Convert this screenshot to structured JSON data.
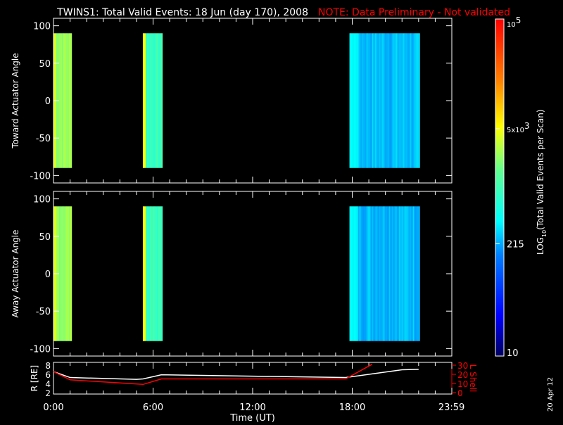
{
  "title": {
    "main": "TWINS1: Total Valid Events: 18 Jun (day 170), 2008",
    "note": "NOTE: Data Preliminary - Not validated",
    "note_color": "#ff0000"
  },
  "side_stamp": "20 Apr 12",
  "chart_data": [
    {
      "type": "heatmap",
      "panel": "top",
      "ylabel": "Toward Actuator Angle",
      "ylim": [
        -110,
        110
      ],
      "yticks": [
        100,
        50,
        0,
        -50,
        -100
      ],
      "xlim_hours": [
        0,
        24
      ],
      "blocks": [
        {
          "start": "0:00",
          "end": "1:03",
          "ymin": -90,
          "ymax": 90,
          "level": 2500,
          "edge_level": 4000
        },
        {
          "start": "5:23",
          "end": "6:32",
          "ymin": -90,
          "ymax": 90,
          "level": 900,
          "edge_level": 5000
        },
        {
          "start": "17:50",
          "end": "22:00",
          "ymin": -90,
          "ymax": 90,
          "level": 260,
          "edge_level": 400
        }
      ]
    },
    {
      "type": "heatmap",
      "panel": "middle",
      "ylabel": "Away Actuator Angle",
      "ylim": [
        -110,
        110
      ],
      "yticks": [
        100,
        50,
        0,
        -50,
        -100
      ],
      "xlim_hours": [
        0,
        24
      ],
      "blocks": [
        {
          "start": "0:00",
          "end": "1:03",
          "ymin": -90,
          "ymax": 90,
          "level": 2500,
          "edge_level": 4000
        },
        {
          "start": "5:23",
          "end": "6:32",
          "ymin": -90,
          "ymax": 90,
          "level": 900,
          "edge_level": 5000
        },
        {
          "start": "17:50",
          "end": "22:00",
          "ymin": -90,
          "ymax": 90,
          "level": 260,
          "edge_level": 400
        }
      ]
    },
    {
      "type": "line",
      "panel": "ephemeris",
      "xlabel": "Time (UT)",
      "xticks": [
        "0:00",
        "6:00",
        "12:00",
        "18:00",
        "23:59"
      ],
      "left_axis": {
        "label": "R [RE]",
        "ylim": [
          2,
          8
        ],
        "ticks": [
          "8",
          "6",
          "4",
          "2"
        ],
        "color": "#ffffff"
      },
      "right_axis": {
        "label": "L Shell",
        "ylim": [
          0,
          30
        ],
        "ticks": [
          "30",
          "20",
          "10",
          "0"
        ],
        "color": "#ff0000"
      },
      "series": [
        {
          "name": "R [RE]",
          "axis": "left",
          "color": "#ffffff",
          "x": [
            0,
            1,
            5,
            5.4,
            6.5,
            12,
            17.6,
            19,
            21,
            22
          ],
          "y": [
            6.6,
            5.3,
            4.9,
            5.0,
            5.9,
            5.6,
            5.3,
            6.0,
            7.0,
            7.1
          ]
        },
        {
          "name": "L Shell",
          "axis": "right",
          "color": "#ff0000",
          "x": [
            0,
            1,
            5.4,
            6.5,
            17.6,
            19.2
          ],
          "y": [
            23,
            14,
            9,
            15,
            15,
            31
          ]
        }
      ]
    },
    {
      "type": "colorbar",
      "label_prefix": "LOG",
      "label_sub": "10",
      "label_rest": "(Total Valid Events per Scan)",
      "scale": "log",
      "range": [
        10,
        100000
      ],
      "ticks": [
        {
          "value": 100000,
          "label": "10",
          "sup": "5"
        },
        {
          "value": 5000,
          "label": "5x10",
          "sup": "3"
        },
        {
          "value": 215,
          "label": "215",
          "sup": ""
        },
        {
          "value": 10,
          "label": "10",
          "sup": ""
        }
      ]
    }
  ]
}
